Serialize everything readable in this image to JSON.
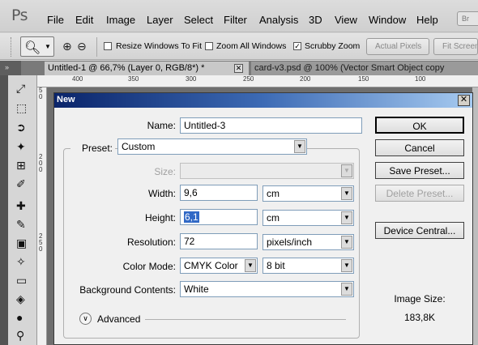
{
  "app": {
    "logo": "Ps",
    "menu": [
      "File",
      "Edit",
      "Image",
      "Layer",
      "Select",
      "Filter",
      "Analysis",
      "3D",
      "View",
      "Window",
      "Help"
    ],
    "br_label": "Br"
  },
  "options": {
    "resize_windows": {
      "label": "Resize Windows To Fit",
      "checked": false
    },
    "zoom_all": {
      "label": "Zoom All Windows",
      "checked": false
    },
    "scrubby": {
      "label": "Scrubby Zoom",
      "checked": true
    },
    "actual_pixels": "Actual Pixels",
    "fit_screen": "Fit Screen"
  },
  "tabs": {
    "collapse": "»",
    "active": "Untitled-1 @ 66,7% (Layer 0, RGB/8*) *",
    "inactive": "card-v3.psd @ 100% (Vector Smart Object copy"
  },
  "ruler": {
    "h_labels": [
      "400",
      "350",
      "300",
      "250",
      "200",
      "150",
      "100"
    ],
    "v_labels": [
      "5 0",
      "2 0 0",
      "2 5 0"
    ]
  },
  "dialog": {
    "title": "New",
    "name_label": "Name:",
    "name_value": "Untitled-3",
    "preset_label": "Preset:",
    "preset_value": "Custom",
    "size_label": "Size:",
    "size_value": "",
    "width_label": "Width:",
    "width_value": "9,6",
    "width_unit": "cm",
    "height_label": "Height:",
    "height_value": "6,1",
    "height_unit": "cm",
    "resolution_label": "Resolution:",
    "resolution_value": "72",
    "resolution_unit": "pixels/inch",
    "color_mode_label": "Color Mode:",
    "color_mode_value": "CMYK Color",
    "bit_depth_value": "8 bit",
    "background_label": "Background Contents:",
    "background_value": "White",
    "advanced_label": "Advanced",
    "buttons": {
      "ok": "OK",
      "cancel": "Cancel",
      "save_preset": "Save Preset...",
      "delete_preset": "Delete Preset...",
      "device_central": "Device Central..."
    },
    "image_size_label": "Image Size:",
    "image_size_value": "183,8K"
  }
}
